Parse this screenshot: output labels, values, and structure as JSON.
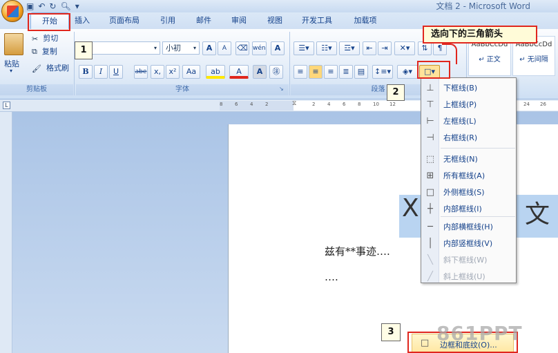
{
  "window": {
    "title": "文档 2 - Microsoft Word"
  },
  "tabs": [
    "开始",
    "插入",
    "页面布局",
    "引用",
    "邮件",
    "审阅",
    "视图",
    "开发工具",
    "加载项"
  ],
  "clipboard": {
    "paste": "粘贴",
    "cut": "剪切",
    "copy": "复制",
    "format_painter": "格式刷",
    "group_label": "剪贴板"
  },
  "font": {
    "size_value": "小初",
    "group_label": "字体",
    "bold": "B",
    "italic": "I",
    "underline": "U",
    "strike": "abe",
    "subscript": "x,",
    "superscript": "x²",
    "case": "Aa",
    "grow": "A",
    "shrink": "A",
    "clear": "A"
  },
  "paragraph": {
    "group_label": "段落"
  },
  "styles": {
    "preview": "AaBbCcDd",
    "normal": "↵ 正文",
    "no_spacing": "↵ 无间隔"
  },
  "ruler": {
    "left_ticks": [
      "8",
      "6",
      "4",
      "2"
    ],
    "right_ticks": [
      "2",
      "4",
      "6",
      "8",
      "10",
      "12"
    ],
    "far_ticks": [
      "24",
      "26"
    ]
  },
  "document": {
    "heading_left": "X",
    "heading_right": "文",
    "line1": "兹有**事迹….",
    "line2": "…."
  },
  "border_menu": {
    "items": [
      {
        "label": "下框线(B)",
        "icon": "bottom-border-icon",
        "glyph": "⊥",
        "disabled": false
      },
      {
        "label": "上框线(P)",
        "icon": "top-border-icon",
        "glyph": "⊤",
        "disabled": false
      },
      {
        "label": "左框线(L)",
        "icon": "left-border-icon",
        "glyph": "⊢",
        "disabled": false
      },
      {
        "label": "右框线(R)",
        "icon": "right-border-icon",
        "glyph": "⊣",
        "disabled": false
      },
      {
        "label": "无框线(N)",
        "icon": "no-border-icon",
        "glyph": "⬚",
        "disabled": false
      },
      {
        "label": "所有框线(A)",
        "icon": "all-borders-icon",
        "glyph": "⊞",
        "disabled": false
      },
      {
        "label": "外侧框线(S)",
        "icon": "outside-borders-icon",
        "glyph": "□",
        "disabled": false
      },
      {
        "label": "内部框线(I)",
        "icon": "inside-borders-icon",
        "glyph": "┼",
        "disabled": false
      },
      {
        "label": "内部横框线(H)",
        "icon": "inside-horizontal-border-icon",
        "glyph": "─",
        "disabled": false
      },
      {
        "label": "内部竖框线(V)",
        "icon": "inside-vertical-border-icon",
        "glyph": "│",
        "disabled": false
      },
      {
        "label": "斜下框线(W)",
        "icon": "diagonal-down-border-icon",
        "glyph": "╲",
        "disabled": true
      },
      {
        "label": "斜上框线(U)",
        "icon": "diagonal-up-border-icon",
        "glyph": "╱",
        "disabled": true
      }
    ],
    "border_shading": "边框和底纹(O)..."
  },
  "annotations": {
    "step1": "1",
    "step2": "2",
    "step3": "3",
    "callout": "选向下的三角箭头"
  },
  "watermark": "861PPT",
  "colors": {
    "accent": "#15428b",
    "highlight": "#e0261d",
    "ribbon": "#dfeaf7"
  }
}
